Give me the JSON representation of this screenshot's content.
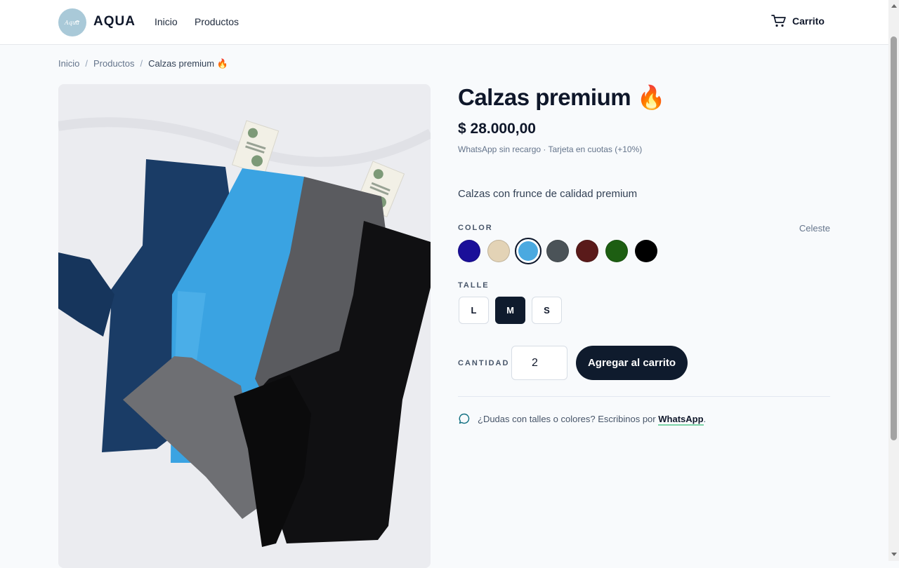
{
  "header": {
    "brand": "AQUA",
    "logo_text": "Aqua",
    "nav": [
      "Inicio",
      "Productos"
    ],
    "cart_label": "Carrito",
    "logo_bg": "#a9c9d8"
  },
  "breadcrumb": {
    "items": [
      "Inicio",
      "Productos"
    ],
    "separator": "/",
    "current": "Calzas premium 🔥"
  },
  "product": {
    "title": "Calzas premium 🔥",
    "price": "$ 28.000,00",
    "payment_note": "WhatsApp sin recargo · Tarjeta en cuotas (+10%)",
    "description": "Calzas con frunce de calidad premium",
    "image_icon": "leggings-photo"
  },
  "color": {
    "label": "COLOR",
    "selected_name": "Celeste",
    "swatches": [
      {
        "hex": "#1a0f99",
        "selected": false
      },
      {
        "hex": "#e3d3b6",
        "selected": false
      },
      {
        "hex": "#4aa9e0",
        "selected": true
      },
      {
        "hex": "#4b5358",
        "selected": false
      },
      {
        "hex": "#5a1a1a",
        "selected": false
      },
      {
        "hex": "#1d5e12",
        "selected": false
      },
      {
        "hex": "#000000",
        "selected": false
      }
    ]
  },
  "size": {
    "label": "TALLE",
    "options": [
      "L",
      "M",
      "S"
    ],
    "selected": "M"
  },
  "quantity": {
    "label": "CANTIDAD",
    "value": "2"
  },
  "add_to_cart_label": "Agregar al carrito",
  "help": {
    "text": "¿Dudas con talles o colores? Escribinos por",
    "link": "WhatsApp",
    "suffix": "."
  },
  "colors": {
    "primary": "#0f1b2d",
    "link_underline": "#7dd3a8"
  }
}
